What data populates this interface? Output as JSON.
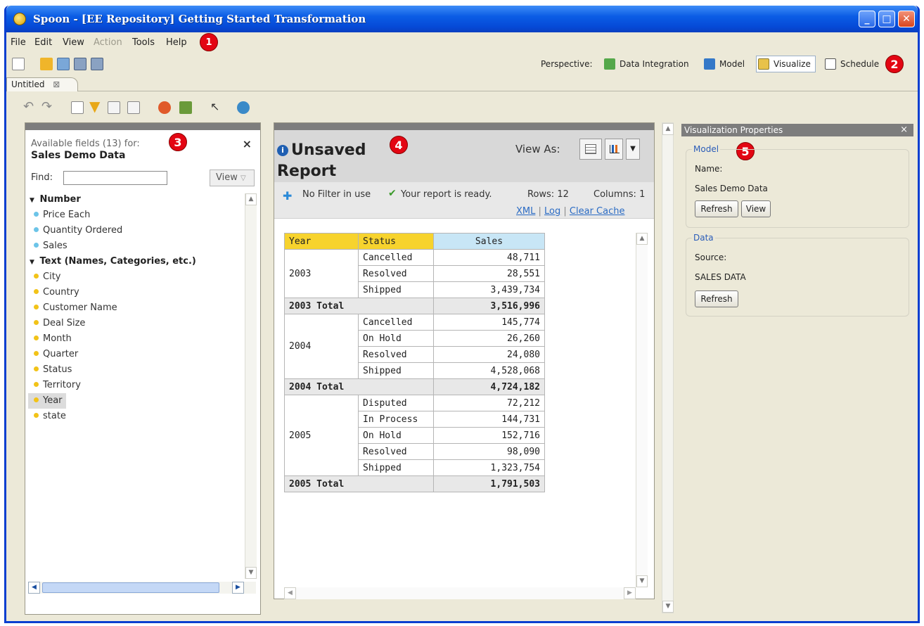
{
  "window": {
    "title": "Spoon - [EE Repository] Getting Started Transformation"
  },
  "menu": [
    "File",
    "Edit",
    "View",
    "Action",
    "Tools",
    "Help"
  ],
  "callouts": [
    "1",
    "2",
    "3",
    "4",
    "5"
  ],
  "perspective": {
    "label": "Perspective:",
    "items": [
      "Data Integration",
      "Model",
      "Visualize",
      "Schedule"
    ],
    "active": "Visualize"
  },
  "tab": {
    "label": "Untitled",
    "close": "⊠"
  },
  "fields_panel": {
    "subtitle": "Available fields (13) for:",
    "model": "Sales Demo Data",
    "close": "×",
    "find_label": "Find:",
    "find_value": "",
    "view_button": "View",
    "groups": [
      {
        "name": "Number",
        "items": [
          "Price Each",
          "Quantity Ordered",
          "Sales"
        ]
      },
      {
        "name": "Text (Names, Categories, etc.)",
        "items": [
          "City",
          "Country",
          "Customer Name",
          "Deal Size",
          "Month",
          "Quarter",
          "Status",
          "Territory",
          "Year",
          "state"
        ]
      }
    ],
    "selected": "Year"
  },
  "report": {
    "title": "Unsaved Report",
    "view_as": "View As:",
    "filter_text": "No Filter in use",
    "ready_text": "Your report is ready.",
    "rows_text": "Rows: 12",
    "columns_text": "Columns: 1",
    "links": [
      "XML",
      "Log",
      "Clear Cache"
    ],
    "headers": [
      "Year",
      "Status",
      "Sales"
    ],
    "blocks": [
      {
        "year": "2003",
        "rows": [
          [
            "Cancelled",
            "48,711"
          ],
          [
            "Resolved",
            "28,551"
          ],
          [
            "Shipped",
            "3,439,734"
          ]
        ],
        "total_label": "2003 Total",
        "total": "3,516,996"
      },
      {
        "year": "2004",
        "rows": [
          [
            "Cancelled",
            "145,774"
          ],
          [
            "On Hold",
            "26,260"
          ],
          [
            "Resolved",
            "24,080"
          ],
          [
            "Shipped",
            "4,528,068"
          ]
        ],
        "total_label": "2004 Total",
        "total": "4,724,182"
      },
      {
        "year": "2005",
        "rows": [
          [
            "Disputed",
            "72,212"
          ],
          [
            "In Process",
            "144,731"
          ],
          [
            "On Hold",
            "152,716"
          ],
          [
            "Resolved",
            "98,090"
          ],
          [
            "Shipped",
            "1,323,754"
          ]
        ],
        "total_label": "2005 Total",
        "total": "1,791,503"
      }
    ]
  },
  "viz_props": {
    "title": "Visualization Properties",
    "close": "×",
    "model_group": "Model",
    "name_label": "Name:",
    "name_value": "Sales Demo Data",
    "refresh": "Refresh",
    "view": "View",
    "data_group": "Data",
    "source_label": "Source:",
    "source_value": "SALES DATA"
  },
  "colors": {
    "title_bar": "#0b5de5",
    "callout": "#e30613",
    "year_header": "#f7d32d",
    "sales_header": "#c8e6f6",
    "link": "#2a6bc4"
  }
}
